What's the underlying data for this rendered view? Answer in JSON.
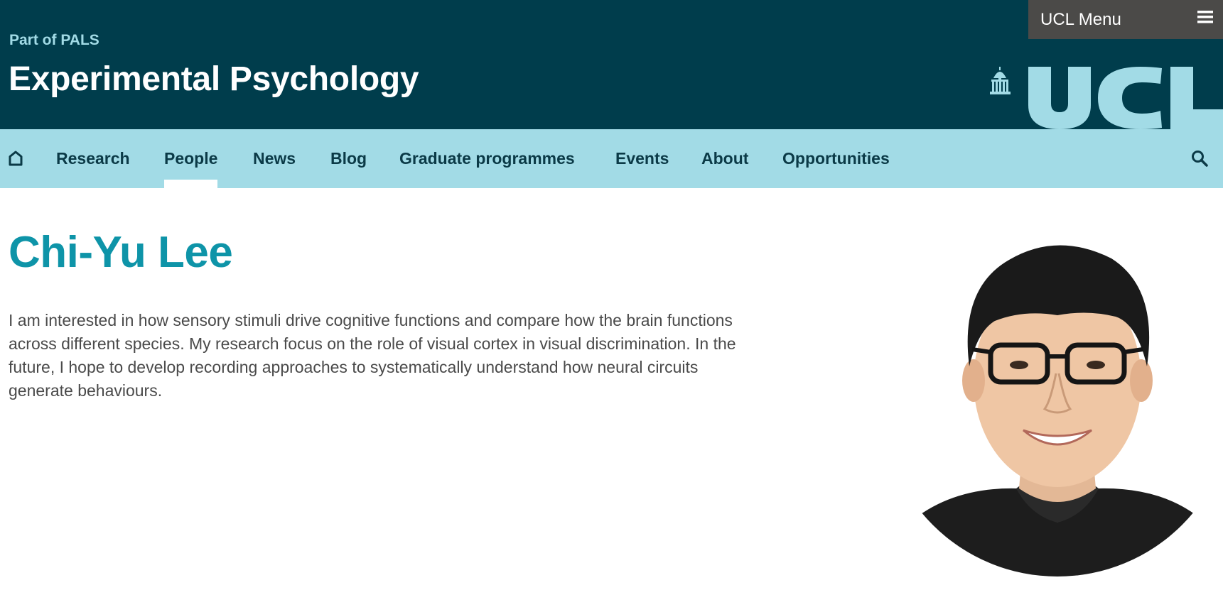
{
  "header": {
    "part_of": "Part of PALS",
    "site_title": "Experimental Psychology",
    "ucl_menu_label": "UCL Menu",
    "logo_text": "UCL"
  },
  "nav": {
    "items": [
      {
        "label": "Research"
      },
      {
        "label": "People"
      },
      {
        "label": "News"
      },
      {
        "label": "Blog"
      },
      {
        "label": "Graduate programmes"
      },
      {
        "label": "Events"
      },
      {
        "label": "About"
      },
      {
        "label": "Opportunities"
      }
    ],
    "active": "People"
  },
  "profile": {
    "name": "Chi-Yu Lee",
    "bio": "I am interested in how sensory stimuli drive cognitive functions and compare how the brain functions across different species. My research focus on the role of visual cortex in visual discrimination. In the future, I hope to develop recording approaches to systematically understand how neural circuits generate behaviours."
  },
  "colors": {
    "header_bg": "#003d4c",
    "nav_bg": "#a2dbe6",
    "accent_name": "#0e94a8",
    "menu_bg": "#4b4a48"
  },
  "icons": [
    "home-icon",
    "hamburger-icon",
    "search-icon",
    "portico-icon"
  ]
}
